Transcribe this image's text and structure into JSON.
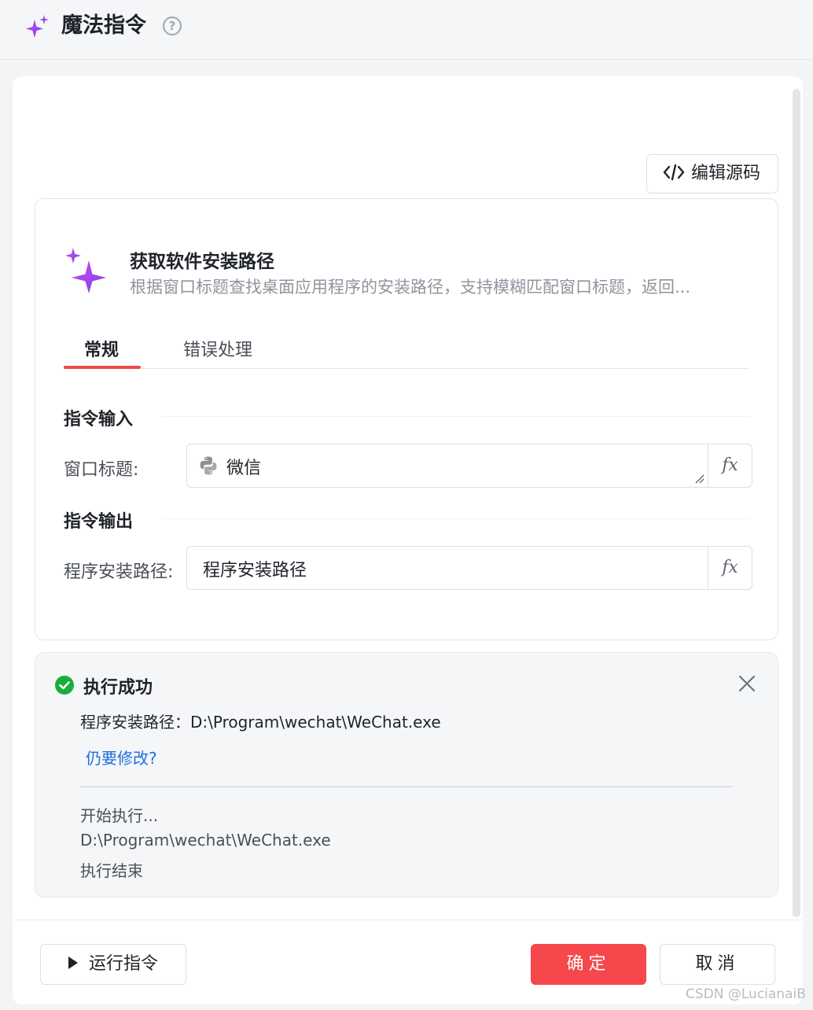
{
  "header": {
    "title": "魔法指令",
    "help_icon": "?"
  },
  "toolbar": {
    "edit_source_label": "编辑源码"
  },
  "command": {
    "title": "获取软件安装路径",
    "description": "根据窗口标题查找桌面应用程序的安装路径，支持模糊匹配窗口标题，返回..."
  },
  "tabs": [
    {
      "label": "常规",
      "active": true
    },
    {
      "label": "错误处理",
      "active": false
    }
  ],
  "input_section": {
    "title": "指令输入",
    "fields": [
      {
        "label": "窗口标题:",
        "value": "微信",
        "icon": "python-icon",
        "fx": "fx"
      }
    ]
  },
  "output_section": {
    "title": "指令输出",
    "fields": [
      {
        "label": "程序安装路径:",
        "value": "程序安装路径",
        "fx": "fx"
      }
    ]
  },
  "result": {
    "status": "执行成功",
    "output_line": "程序安装路径：D:\\Program\\wechat\\WeChat.exe",
    "modify_link": "仍要修改?",
    "log": [
      "开始执行...",
      "D:\\Program\\wechat\\WeChat.exe",
      "执行结束"
    ]
  },
  "footer": {
    "run_label": "运行指令",
    "confirm_label": "确定",
    "cancel_label": "取消"
  },
  "watermark": "CSDN @LucianaiB",
  "colors": {
    "accent": "#f5474c",
    "success": "#1aad3a",
    "link": "#1a6fe0",
    "sparkle": "#a855f7"
  }
}
